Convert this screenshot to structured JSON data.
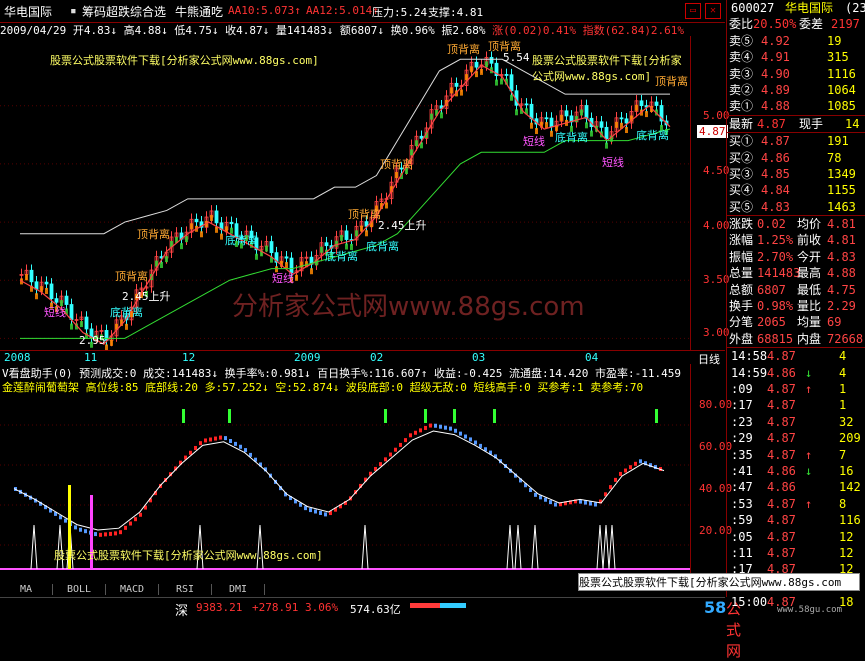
{
  "top": {
    "stock": "华电国际",
    "menu": [
      "筹码超跌综合选",
      "牛熊通吃"
    ],
    "aa10": "AA10:5.073↑",
    "aa12": "AA12:5.014↑",
    "pressure": "压力:5.24",
    "support": "支撑:4.81"
  },
  "info": {
    "date": "2009/04/29",
    "open": "开4.83↓",
    "high": "高4.88↓",
    "low": "低4.75↓",
    "close": "收4.87↓",
    "vol": "量141483↓",
    "amount": "额6807↓",
    "turn": "换0.96%",
    "amp": "振2.68%",
    "change": "涨(0.02)0.41%",
    "index": "指数(62.84)2.61%"
  },
  "watermarks": {
    "w1": "股票公式股票软件下载[分析家公式网www.88gs.com]",
    "w2": "股票公式股票软件下载[分析家公式网www.88gs.com]",
    "big": "分析家公式网www.88gs.com",
    "w3": "股票公式股票软件下载[分析家公式网www.88gs.com]",
    "w4": "股票公式股票软件下载[分析家公式网www.88gs.com]"
  },
  "annotations": {
    "top1": "顶背离",
    "top2": "顶背离",
    "top3": "顶背离",
    "top4": "顶背离",
    "top5": "顶背离",
    "top6": "顶背离",
    "top7": "顶背离",
    "bot1": "底背离",
    "bot2": "底背离",
    "bot3": "底背离",
    "bot4": "底背离",
    "bot5": "底背离",
    "bot6": "底背离",
    "short1": "短线",
    "short2": "短线",
    "short3": "短线",
    "short4": "短线",
    "up1": "2.45上升",
    "up2": "2.45上升",
    "hi": "5.54",
    "lo": "2.95",
    "now": "4.87"
  },
  "chart_data": {
    "type": "line",
    "title": "",
    "x": [
      "2008",
      "11",
      "12",
      "2009",
      "02",
      "03",
      "04"
    ],
    "ylim": [
      2.9,
      5.6
    ],
    "yticks": [
      "5.00",
      "4.50",
      "4.00",
      "3.50",
      "3.00"
    ],
    "period": "日线",
    "high_label": 5.54,
    "low_label": 2.95,
    "last": 4.87,
    "series": [
      {
        "name": "",
        "values": [
          3.55,
          3.45,
          3.3,
          3.1,
          3.0,
          3.2,
          3.5,
          3.8,
          3.95,
          4.05,
          3.95,
          3.85,
          3.75,
          3.6,
          3.7,
          3.85,
          3.9,
          4.1,
          4.4,
          4.7,
          5.0,
          5.2,
          5.4,
          5.3,
          5.0,
          4.85,
          4.9,
          4.95,
          4.75,
          4.9,
          5.05,
          4.87
        ]
      }
    ],
    "oscillator": {
      "yticks": [
        "80.00",
        "60.00",
        "40.00",
        "20.00"
      ],
      "ylim": [
        5,
        95
      ],
      "values": [
        48,
        42,
        35,
        28,
        25,
        26,
        35,
        50,
        62,
        72,
        74,
        68,
        58,
        45,
        38,
        35,
        42,
        55,
        65,
        75,
        80,
        78,
        72,
        65,
        55,
        45,
        40,
        42,
        40,
        55,
        62,
        58
      ]
    }
  },
  "sub": {
    "line1": "V看盘助手(0) 预测成交:0 成交:141483↓ 换手率%:0.981↓ 百日换手%:116.607↑ 收益:-0.425 流通盘:14.420 市盈率:-11.459",
    "line2": "金莲醉闹葡萄架 高位线:85 底部线:20 多:57.252↓ 空:52.874↓ 波段底部:0 超级无敌:0 短线高手:0 买参考:1 卖参考:70"
  },
  "tabs": [
    "MA",
    "BOLL",
    "MACD",
    "RSI",
    "DMI"
  ],
  "status": {
    "label": "深",
    "index": "9383.21",
    "change": "+278.91",
    "pct": "3.06%",
    "amount": "574.63亿"
  },
  "right": {
    "code": "600027",
    "name": "华电国际",
    "extra": "(23",
    "wb": "委比",
    "wb_val": "20.50%",
    "wc": "委差",
    "wc_val": "2197",
    "sells": [
      {
        "l": "卖⑤",
        "p": "4.92",
        "v": "19"
      },
      {
        "l": "卖④",
        "p": "4.91",
        "v": "315"
      },
      {
        "l": "卖③",
        "p": "4.90",
        "v": "1116"
      },
      {
        "l": "卖②",
        "p": "4.89",
        "v": "1064"
      },
      {
        "l": "卖①",
        "p": "4.88",
        "v": "1085"
      }
    ],
    "last_label": "最新",
    "last": "4.87",
    "hand_label": "现手",
    "hand": "14",
    "buys": [
      {
        "l": "买①",
        "p": "4.87",
        "v": "191"
      },
      {
        "l": "买②",
        "p": "4.86",
        "v": "78"
      },
      {
        "l": "买③",
        "p": "4.85",
        "v": "1349"
      },
      {
        "l": "买④",
        "p": "4.84",
        "v": "1155"
      },
      {
        "l": "买⑤",
        "p": "4.83",
        "v": "1463"
      }
    ],
    "stats": [
      {
        "a": "涨跌",
        "b": "0.02",
        "c": "均价",
        "d": "4.81"
      },
      {
        "a": "涨幅",
        "b": "1.25%",
        "c": "前收",
        "d": "4.81"
      },
      {
        "a": "振幅",
        "b": "2.70%",
        "c": "今开",
        "d": "4.83"
      },
      {
        "a": "总量",
        "b": "141483",
        "c": "最高",
        "d": "4.88"
      },
      {
        "a": "总额",
        "b": "6807",
        "c": "最低",
        "d": "4.75"
      },
      {
        "a": "换手",
        "b": "0.98%",
        "c": "量比",
        "d": "2.29"
      },
      {
        "a": "分笔",
        "b": "2065",
        "c": "均量",
        "d": "69"
      },
      {
        "a": "外盘",
        "b": "68815",
        "c": "内盘",
        "d": "72668"
      }
    ],
    "ticks": [
      {
        "t": "14:58",
        "p": "4.87",
        "v": "4"
      },
      {
        "t": "14:59",
        "p": "4.86",
        "v": "4",
        "a": "↓"
      },
      {
        "t": ":09",
        "p": "4.87",
        "v": "1",
        "a": "↑"
      },
      {
        "t": ":17",
        "p": "4.87",
        "v": "1"
      },
      {
        "t": ":23",
        "p": "4.87",
        "v": "32"
      },
      {
        "t": ":29",
        "p": "4.87",
        "v": "209"
      },
      {
        "t": ":35",
        "p": "4.87",
        "v": "7",
        "a": "↑"
      },
      {
        "t": ":41",
        "p": "4.86",
        "v": "16",
        "a": "↓"
      },
      {
        "t": ":47",
        "p": "4.86",
        "v": "142"
      },
      {
        "t": ":53",
        "p": "4.87",
        "v": "8",
        "a": "↑"
      },
      {
        "t": ":59",
        "p": "4.87",
        "v": "116"
      },
      {
        "t": ":05",
        "p": "4.87",
        "v": "12"
      },
      {
        "t": ":11",
        "p": "4.87",
        "v": "12"
      },
      {
        "t": ":17",
        "p": "4.87",
        "v": "12"
      },
      {
        "t": ":23",
        "p": "4.87",
        "v": "105"
      },
      {
        "t": "15:00",
        "p": "4.87",
        "v": "18"
      }
    ],
    "ad": "股票公式股票软件下载[分析家公式网www.88gs.com"
  },
  "logo": {
    "num": "58",
    "txt": "公式网",
    "url": "www.58gu.com"
  }
}
